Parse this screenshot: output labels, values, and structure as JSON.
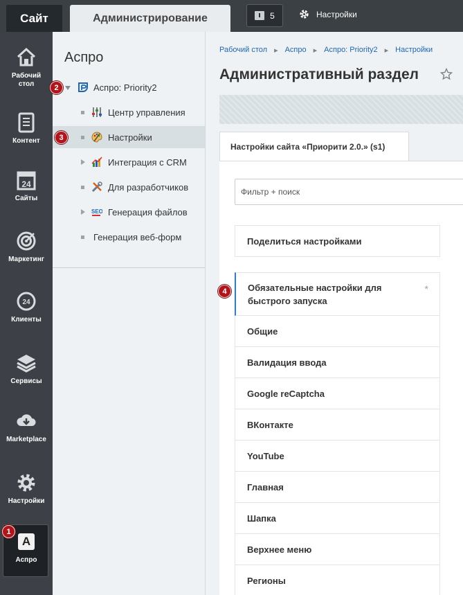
{
  "topbar": {
    "site_tab": "Сайт",
    "admin_tab": "Администрирование",
    "notifications_count": "5",
    "settings_label": "Настройки"
  },
  "left_menu": {
    "items": [
      {
        "label": "Рабочий стол",
        "icon": "home-icon"
      },
      {
        "label": "Контент",
        "icon": "document-icon"
      },
      {
        "label": "Сайты",
        "icon": "calendar-24-icon"
      },
      {
        "label": "Маркетинг",
        "icon": "target-icon"
      },
      {
        "label": "Клиенты",
        "icon": "clients-24-icon"
      },
      {
        "label": "Сервисы",
        "icon": "layers-icon"
      },
      {
        "label": "Marketplace",
        "icon": "cloud-download-icon"
      },
      {
        "label": "Настройки",
        "icon": "gear-icon"
      },
      {
        "label": "Аспро",
        "icon": "aspro-a-icon"
      }
    ],
    "active_item": "Аспро"
  },
  "tree": {
    "title": "Аспро",
    "root": "Аспро: Priority2",
    "items": [
      {
        "label": "Центр управления",
        "icon": "sliders-icon"
      },
      {
        "label": "Настройки",
        "icon": "palette-icon"
      },
      {
        "label": "Интеграция с CRM",
        "icon": "chart-icon"
      },
      {
        "label": "Для разработчиков",
        "icon": "tools-icon"
      },
      {
        "label": "Генерация файлов",
        "icon": "seo-icon"
      },
      {
        "label": "Генерация веб-форм",
        "icon": ""
      }
    ],
    "selected": "Настройки"
  },
  "breadcrumbs": [
    "Рабочий стол",
    "Аспро",
    "Аспро: Priority2",
    "Настройки"
  ],
  "page_title": "Административный раздел",
  "site_tab": "Настройки сайта «Приорити 2.0.» (s1)",
  "filter_placeholder": "Фильтр + поиск",
  "share_button": "Поделиться настройками",
  "settings_list": [
    "Обязательные настройки для быстрого запуска",
    "Общие",
    "Валидация ввода",
    "Google reCaptcha",
    "ВКонтакте",
    "YouTube",
    "Главная",
    "Шапка",
    "Верхнее меню",
    "Регионы"
  ],
  "required_marker": "*",
  "badges": [
    "1",
    "2",
    "3",
    "4"
  ],
  "colors": {
    "topbar": "#3b4044",
    "left_menu": "#3d4147",
    "badge": "#b1141b",
    "link": "#2067b0",
    "active_border": "#2f7bd4"
  }
}
